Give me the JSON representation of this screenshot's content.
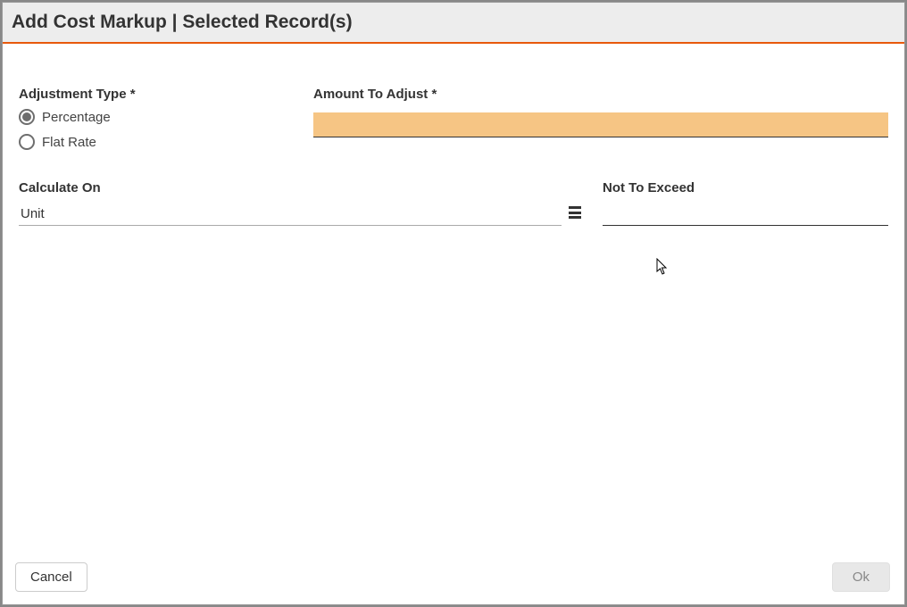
{
  "header": {
    "title": "Add Cost Markup | Selected Record(s)"
  },
  "form": {
    "adjustmentType": {
      "label": "Adjustment Type *",
      "options": {
        "percentage": "Percentage",
        "flatRate": "Flat Rate"
      },
      "selected": "percentage"
    },
    "amountToAdjust": {
      "label": "Amount To Adjust *",
      "value": ""
    },
    "calculateOn": {
      "label": "Calculate On",
      "value": "Unit"
    },
    "notToExceed": {
      "label": "Not To Exceed",
      "value": ""
    }
  },
  "footer": {
    "cancel": "Cancel",
    "ok": "Ok"
  }
}
